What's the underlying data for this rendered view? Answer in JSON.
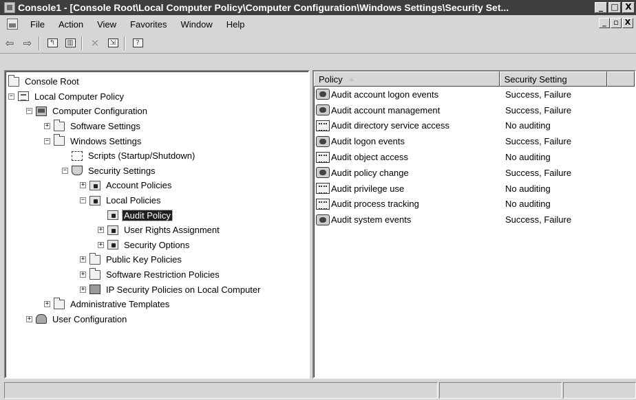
{
  "window": {
    "title": "Console1 - [Console Root\\Local Computer Policy\\Computer Configuration\\Windows Settings\\Security Set...",
    "controls": [
      "_",
      "□",
      "X"
    ]
  },
  "menubar": {
    "items": [
      "File",
      "Action",
      "View",
      "Favorites",
      "Window",
      "Help"
    ],
    "mdi_controls": [
      "_",
      "▫",
      "X"
    ]
  },
  "toolbar": {
    "buttons": [
      "back-icon",
      "forward-icon",
      "up-one-level-icon",
      "show-hide-tree-icon",
      "delete-icon",
      "export-list-icon",
      "help-icon"
    ]
  },
  "tree": {
    "nodes": [
      {
        "label": "Console Root",
        "icon": "folder-icon",
        "expander": ""
      },
      {
        "label": "Local Computer Policy",
        "icon": "policy-icon",
        "expander": "−"
      },
      {
        "label": "Computer Configuration",
        "icon": "computer-icon",
        "expander": "−"
      },
      {
        "label": "Software Settings",
        "icon": "folder-icon",
        "expander": "+"
      },
      {
        "label": "Windows Settings",
        "icon": "folder-icon",
        "expander": "−"
      },
      {
        "label": "Scripts (Startup/Shutdown)",
        "icon": "script-icon",
        "expander": ""
      },
      {
        "label": "Security Settings",
        "icon": "shield-icon",
        "expander": "−"
      },
      {
        "label": "Account Policies",
        "icon": "lock-folder-icon",
        "expander": "+"
      },
      {
        "label": "Local Policies",
        "icon": "lock-folder-icon",
        "expander": "−"
      },
      {
        "label": "Audit Policy",
        "icon": "lock-folder-icon",
        "expander": "",
        "selected": true
      },
      {
        "label": "User Rights Assignment",
        "icon": "lock-folder-icon",
        "expander": "+"
      },
      {
        "label": "Security Options",
        "icon": "lock-folder-icon",
        "expander": "+"
      },
      {
        "label": "Public Key Policies",
        "icon": "folder-icon",
        "expander": "+"
      },
      {
        "label": "Software Restriction Policies",
        "icon": "folder-icon",
        "expander": "+"
      },
      {
        "label": "IP Security Policies on Local Computer",
        "icon": "ipsec-icon",
        "expander": "+"
      },
      {
        "label": "Administrative Templates",
        "icon": "folder-icon",
        "expander": "+"
      },
      {
        "label": "User Configuration",
        "icon": "user-icon",
        "expander": "+"
      }
    ]
  },
  "list": {
    "columns": [
      "Policy",
      "Security Setting",
      ""
    ],
    "sort_indicator": "▲",
    "rows": [
      {
        "policy": "Audit account logon events",
        "setting": "Success, Failure",
        "icon": "audit-enabled-icon"
      },
      {
        "policy": "Audit account management",
        "setting": "Success, Failure",
        "icon": "audit-enabled-icon"
      },
      {
        "policy": "Audit directory service access",
        "setting": "No auditing",
        "icon": "audit-disabled-icon"
      },
      {
        "policy": "Audit logon events",
        "setting": "Success, Failure",
        "icon": "audit-enabled-icon"
      },
      {
        "policy": "Audit object access",
        "setting": "No auditing",
        "icon": "audit-disabled-icon"
      },
      {
        "policy": "Audit policy change",
        "setting": "Success, Failure",
        "icon": "audit-enabled-icon"
      },
      {
        "policy": "Audit privilege use",
        "setting": "No auditing",
        "icon": "audit-disabled-icon"
      },
      {
        "policy": "Audit process tracking",
        "setting": "No auditing",
        "icon": "audit-disabled-icon"
      },
      {
        "policy": "Audit system events",
        "setting": "Success, Failure",
        "icon": "audit-enabled-icon"
      }
    ]
  },
  "statusbar": {
    "panels": [
      "",
      "",
      ""
    ]
  }
}
